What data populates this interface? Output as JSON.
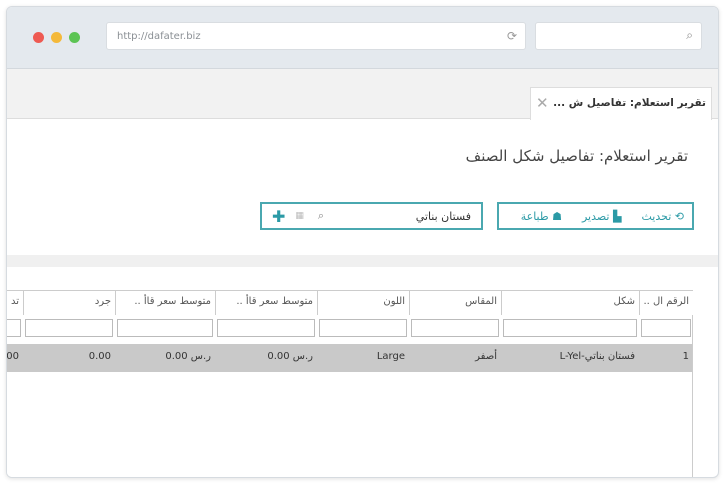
{
  "browser": {
    "url": "http://dafater.biz",
    "colors": {
      "close": "#ee5a52",
      "min": "#f4b93a",
      "max": "#5cc454"
    }
  },
  "tab": {
    "label": "تقرير استعلام: تفاصيل ش ...",
    "close": "✕"
  },
  "page": {
    "title": "تقرير استعلام: تفاصيل شكل الصنف"
  },
  "toolbar": {
    "refresh": "تحديث",
    "export": "تصدير",
    "print": "طباعة"
  },
  "filter": {
    "value": "فستان بناتي"
  },
  "table": {
    "headers": [
      "الرقم ال ..",
      "شكل",
      "المقاس",
      "اللون",
      "متوسط سعر قاأ ..",
      "متوسط سعر قاأ ..",
      "جرد",
      "تد"
    ],
    "rows": [
      [
        "1",
        "فستان بناتي-L-Yel",
        "أصفر",
        "Large",
        "ر.س 0.00",
        "ر.س 0.00",
        "0.00",
        "00"
      ]
    ]
  },
  "accent": "#4aa8b0"
}
